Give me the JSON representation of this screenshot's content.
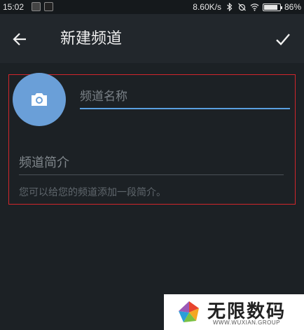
{
  "status_bar": {
    "time": "15:02",
    "network_speed": "8.60K/s",
    "battery_percent": "86%",
    "battery_level": 0.86,
    "icons": [
      "bluetooth-icon",
      "alarm-off-icon",
      "wifi-icon",
      "battery-icon"
    ]
  },
  "app_bar": {
    "title": "新建频道",
    "back_icon": "arrow-left-icon",
    "done_icon": "check-icon"
  },
  "form": {
    "avatar_icon": "camera-icon",
    "name_placeholder": "频道名称",
    "name_value": "",
    "description_placeholder": "频道简介",
    "description_value": "",
    "hint": "您可以给您的频道添加一段简介。"
  },
  "watermark": {
    "title": "无限数码",
    "subtitle": "WWW.WUXIAN.GROUP"
  },
  "colors": {
    "background": "#1c2125",
    "app_bar": "#22272c",
    "accent": "#5a9fe0",
    "avatar": "#6a9fd8",
    "highlight_border": "#d0262c"
  }
}
